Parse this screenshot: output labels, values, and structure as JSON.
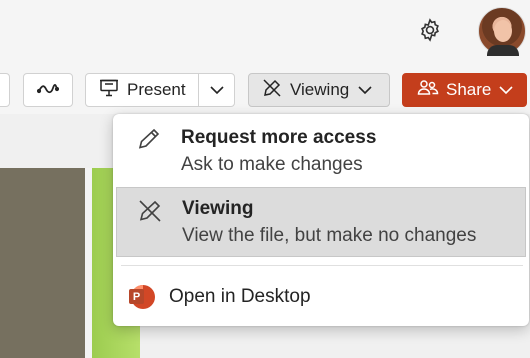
{
  "toolbar": {
    "present_label": "Present",
    "viewing_label": "Viewing",
    "share_label": "Share"
  },
  "menu": {
    "request": {
      "title": "Request more access",
      "description": "Ask to make changes"
    },
    "viewing": {
      "title": "Viewing",
      "description": "View the file, but make no changes"
    },
    "open_desktop": "Open in Desktop"
  },
  "colors": {
    "share_accent": "#c43e1c",
    "powerpoint": "#d24726",
    "selected_item_bg": "#dcdcdc"
  },
  "icons": {
    "settings": "gear-icon",
    "present": "present-icon",
    "viewing": "no-edit-pencil-icon",
    "share": "people-icon",
    "request": "pencil-icon",
    "open_desktop": "powerpoint-icon"
  }
}
